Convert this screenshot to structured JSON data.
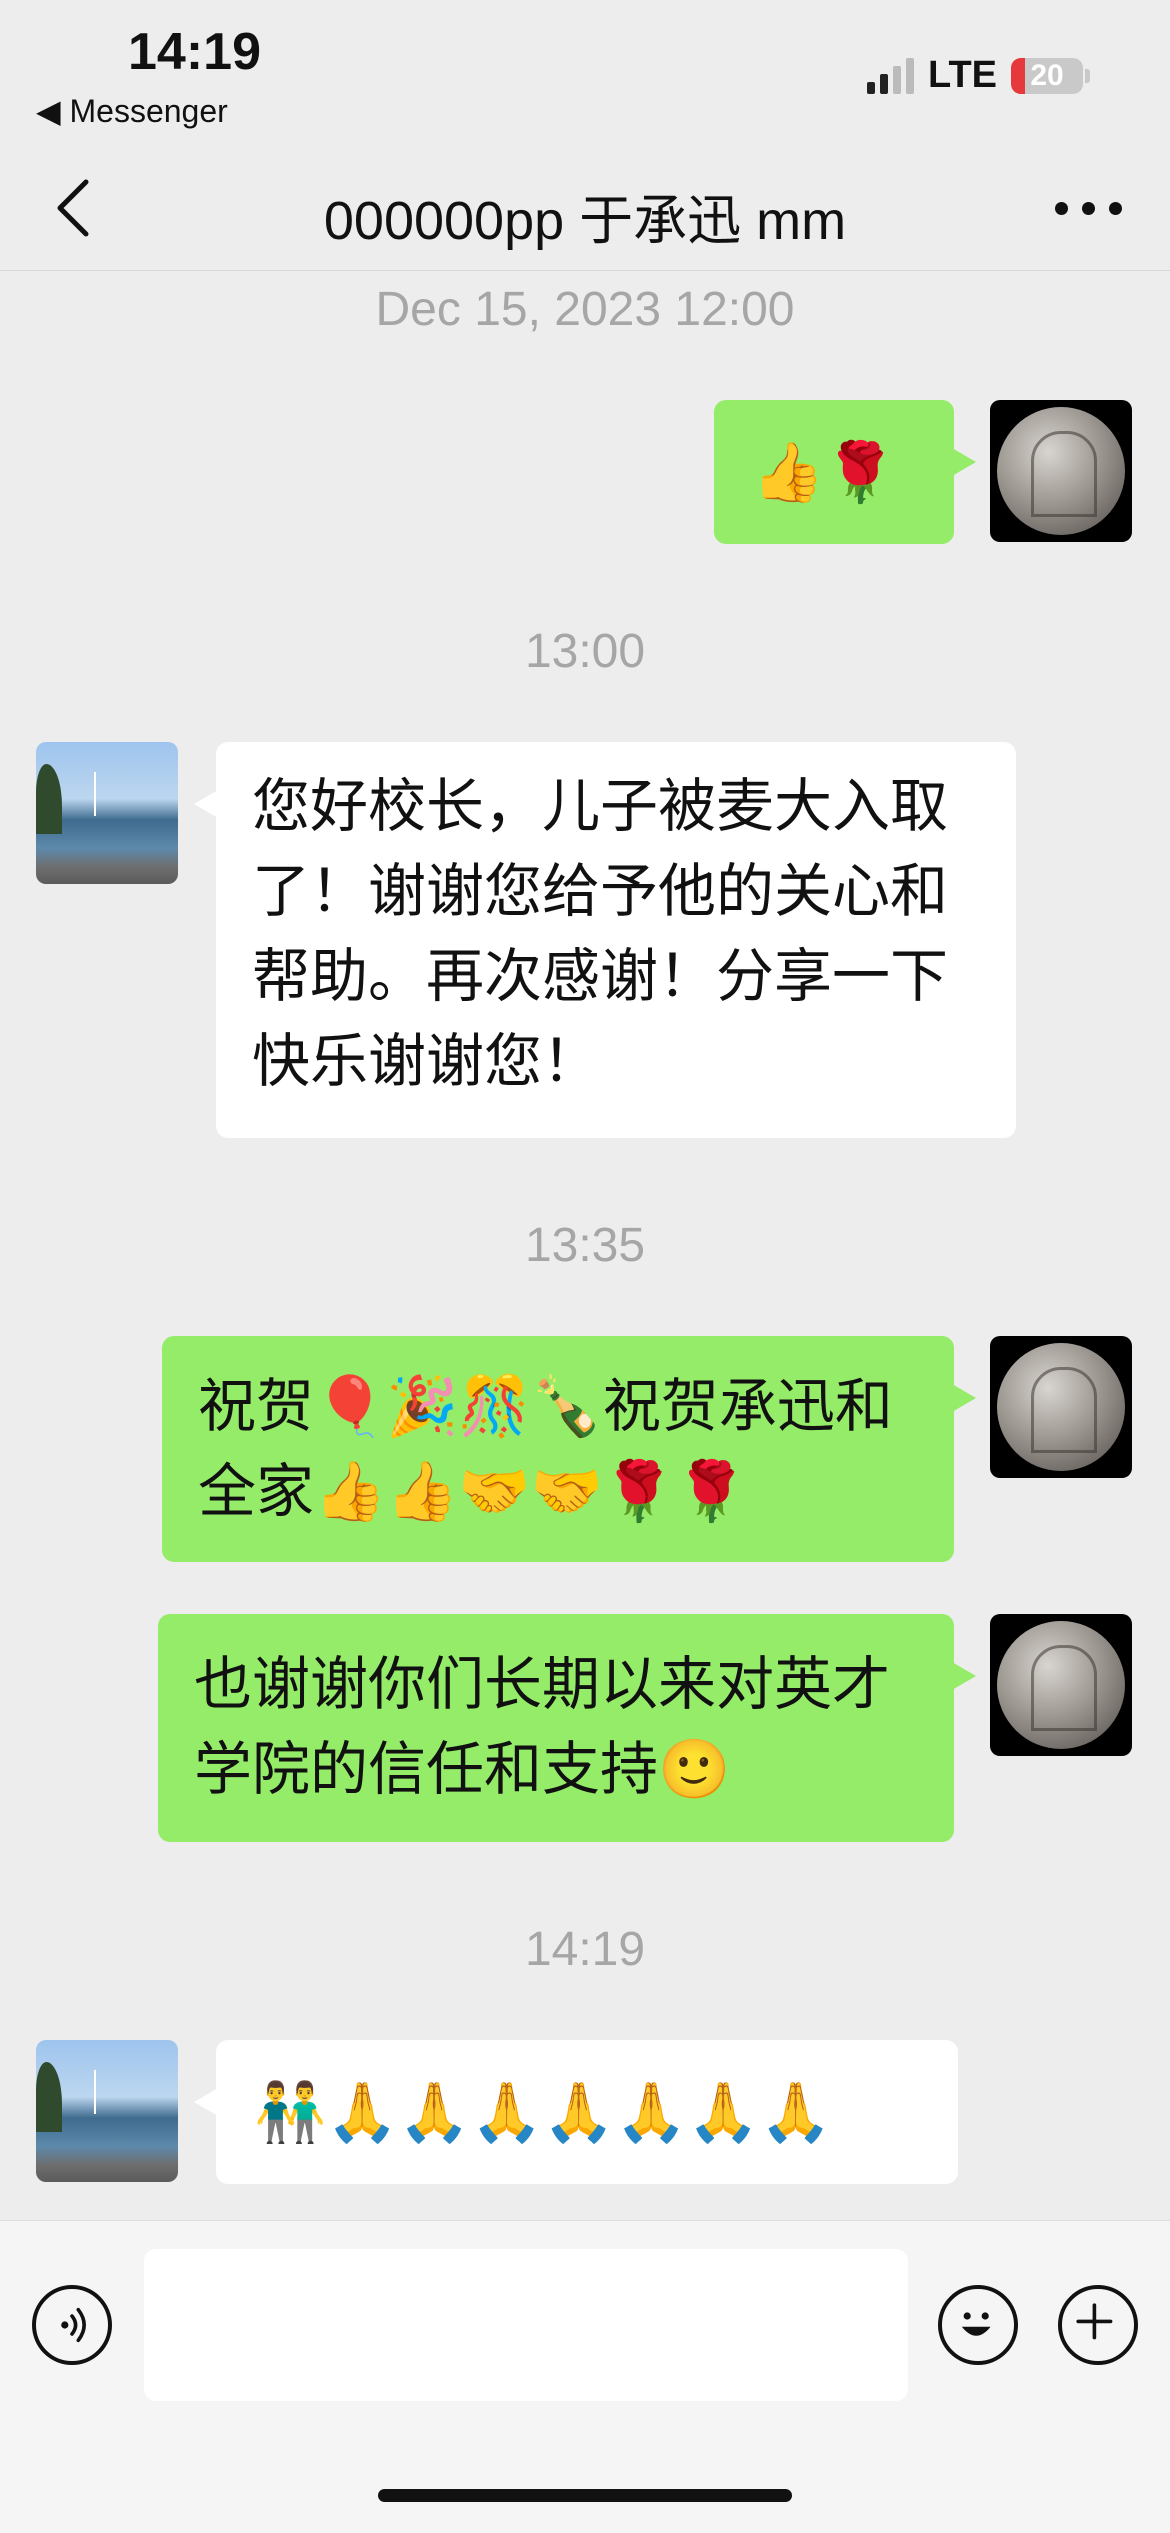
{
  "status_bar": {
    "time": "14:19",
    "back_app": "Messenger",
    "network": "LTE",
    "battery": "20",
    "battery_level": 0.2,
    "signal_bars_filled": 2
  },
  "header": {
    "title": "000000pp 于承迅 mm"
  },
  "messages": [
    {
      "type": "timestamp",
      "text": "Dec 15, 2023 12:00"
    },
    {
      "type": "message",
      "sender": "me",
      "text": "👍🌹"
    },
    {
      "type": "timestamp",
      "text": "13:00"
    },
    {
      "type": "message",
      "sender": "them",
      "text": "您好校长，儿子被麦大入取了！谢谢您给予他的关心和帮助。再次感谢！分享一下快乐谢谢您！"
    },
    {
      "type": "timestamp",
      "text": "13:35"
    },
    {
      "type": "message",
      "sender": "me",
      "text": "祝贺🎈🎉🎊🍾祝贺承迅和全家👍👍🤝🤝🌹🌹"
    },
    {
      "type": "message",
      "sender": "me",
      "text": "也谢谢你们长期以来对英才学院的信任和支持🙂"
    },
    {
      "type": "timestamp",
      "text": "14:19"
    },
    {
      "type": "message",
      "sender": "them",
      "text": "👬🙏🙏🙏🙏🙏🙏🙏"
    }
  ],
  "input": {
    "value": "",
    "placeholder": ""
  },
  "icons": {
    "back": "chevron-left-icon",
    "more": "more-dots-icon",
    "voice": "voice-icon",
    "emoji": "emoji-icon",
    "plus": "plus-icon"
  }
}
